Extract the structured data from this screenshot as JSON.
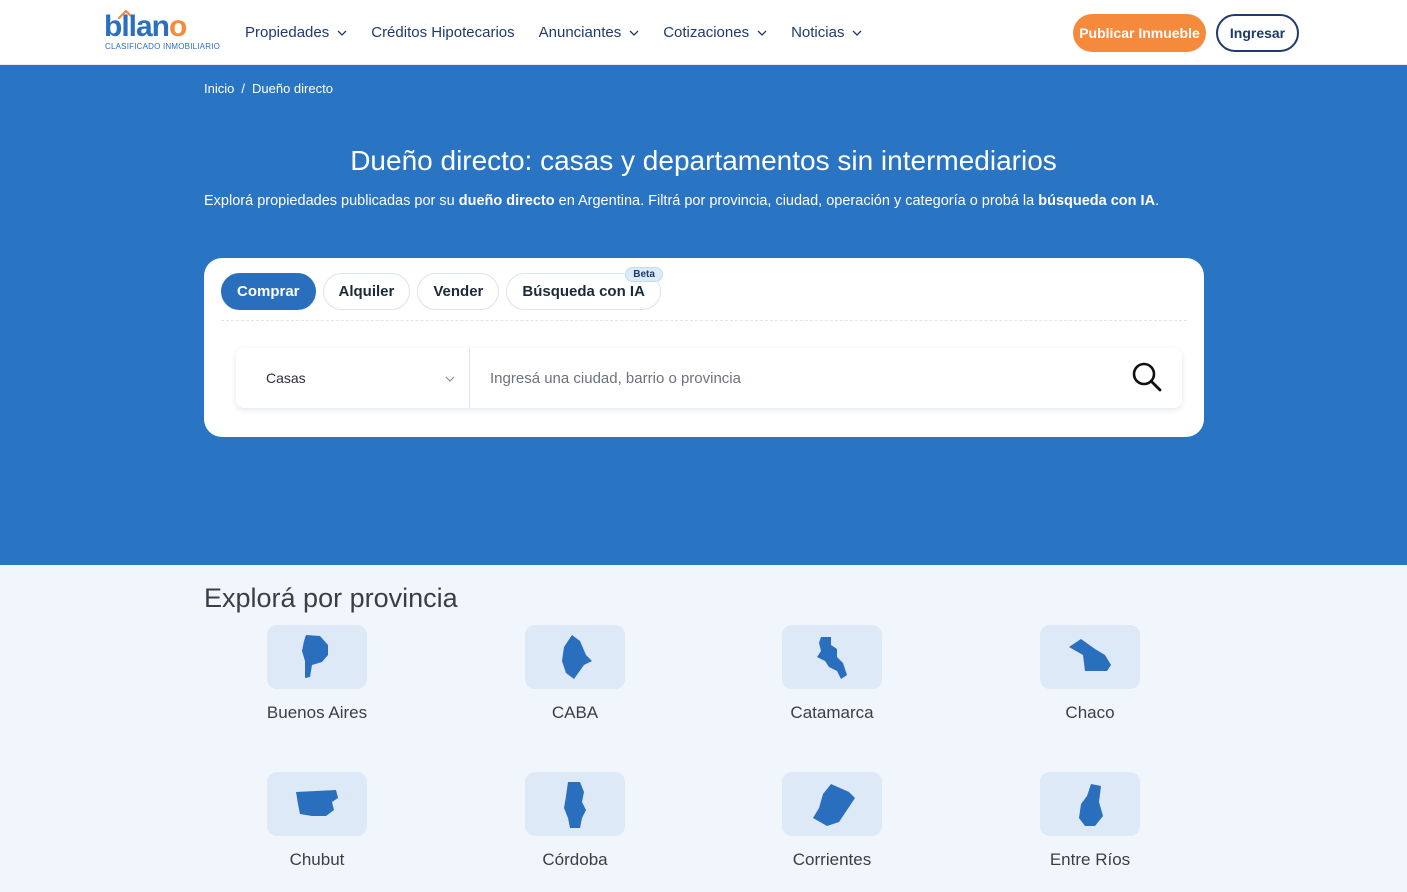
{
  "header": {
    "logo": {
      "word": "bllan",
      "word_end": "o",
      "subtitle": "CLASIFICADO INMOBILIARIO"
    },
    "nav": [
      {
        "label": "Propiedades",
        "has_dropdown": true
      },
      {
        "label": "Créditos Hipotecarios",
        "has_dropdown": false
      },
      {
        "label": "Anunciantes",
        "has_dropdown": true
      },
      {
        "label": "Cotizaciones",
        "has_dropdown": true
      },
      {
        "label": "Noticias",
        "has_dropdown": true
      }
    ],
    "publish_label": "Publicar Inmueble",
    "login_label": "Ingresar"
  },
  "breadcrumb": {
    "home": "Inicio",
    "separator": "/",
    "current": "Dueño directo"
  },
  "hero": {
    "title": "Dueño directo: casas y departamentos sin intermediarios",
    "subtitle_a": "Explorá propiedades publicadas por su ",
    "subtitle_b": "dueño directo",
    "subtitle_c": " en Argentina. Filtrá por provincia, ciudad, operación y categoría o probá la ",
    "subtitle_d": "búsqueda con IA",
    "subtitle_e": "."
  },
  "search": {
    "tabs": [
      {
        "label": "Comprar",
        "active": true
      },
      {
        "label": "Alquiler",
        "active": false
      },
      {
        "label": "Vender",
        "active": false
      },
      {
        "label": "Búsqueda con IA",
        "active": false,
        "badge": "Beta"
      }
    ],
    "category_selected": "Casas",
    "placeholder": "Ingresá una ciudad, barrio o provincia",
    "search_icon": "search-icon"
  },
  "provinces": {
    "title": "Explorá por provincia",
    "items": [
      {
        "name": "Buenos Aires",
        "icon": "buenos-aires-map-icon"
      },
      {
        "name": "CABA",
        "icon": "caba-map-icon"
      },
      {
        "name": "Catamarca",
        "icon": "catamarca-map-icon"
      },
      {
        "name": "Chaco",
        "icon": "chaco-map-icon"
      },
      {
        "name": "Chubut",
        "icon": "chubut-map-icon"
      },
      {
        "name": "Córdoba",
        "icon": "cordoba-map-icon"
      },
      {
        "name": "Corrientes",
        "icon": "corrientes-map-icon"
      },
      {
        "name": "Entre Ríos",
        "icon": "entre-rios-map-icon"
      }
    ]
  },
  "colors": {
    "brand_blue": "#2a74c4",
    "accent_orange": "#f58a3c",
    "nav_text": "#1f3a6b",
    "tile_bg": "#dde9f6",
    "page_bg": "#f1f6fc"
  }
}
